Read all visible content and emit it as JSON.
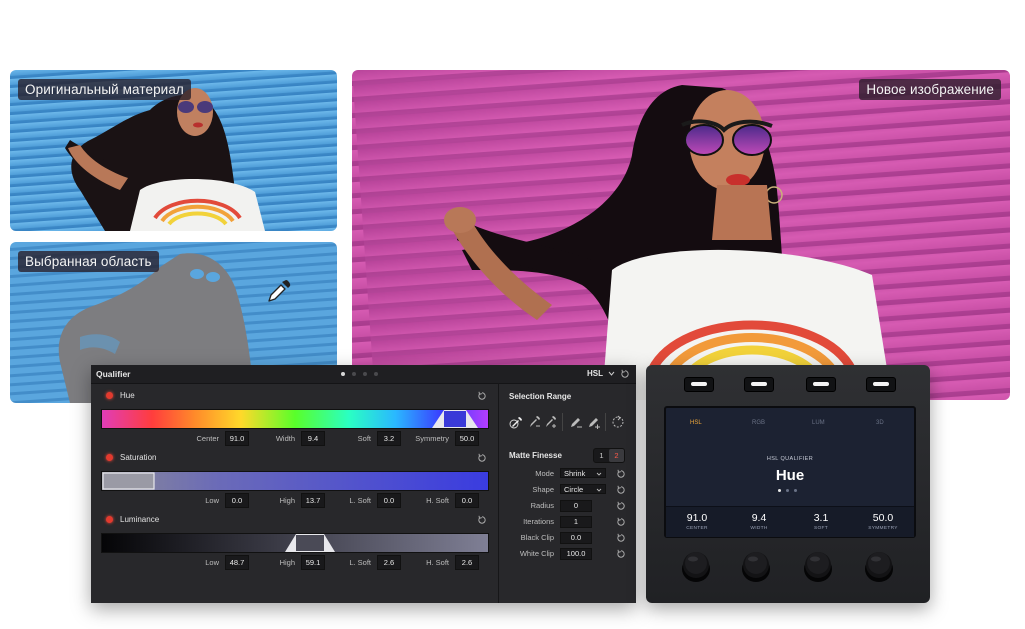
{
  "captions": {
    "original": "Оригинальный материал",
    "selected": "Выбранная область",
    "new_image": "Новое изображение"
  },
  "colors": {
    "original_wall": "#58a8e0",
    "new_wall": "#c94fa6",
    "panel_bg": "#28282b",
    "led_red": "#e23a2e",
    "screen_active_tab": "#f0a83a"
  },
  "qualifier": {
    "title": "Qualifier",
    "mode": "HSL",
    "mode_icon": "chevron-down-icon",
    "page_dots": 4,
    "active_page": 1,
    "hue": {
      "label": "Hue",
      "fields": [
        {
          "label": "Center",
          "value": "91.0"
        },
        {
          "label": "Width",
          "value": "9.4"
        },
        {
          "label": "Soft",
          "value": "3.2"
        },
        {
          "label": "Symmetry",
          "value": "50.0"
        }
      ]
    },
    "saturation": {
      "label": "Saturation",
      "fields": [
        {
          "label": "Low",
          "value": "0.0"
        },
        {
          "label": "High",
          "value": "13.7"
        },
        {
          "label": "L. Soft",
          "value": "0.0"
        },
        {
          "label": "H. Soft",
          "value": "0.0"
        }
      ]
    },
    "luminance": {
      "label": "Luminance",
      "fields": [
        {
          "label": "Low",
          "value": "48.7"
        },
        {
          "label": "High",
          "value": "59.1"
        },
        {
          "label": "L. Soft",
          "value": "2.6"
        },
        {
          "label": "H. Soft",
          "value": "2.6"
        }
      ]
    },
    "selection_range": {
      "title": "Selection Range",
      "tools": [
        "eyedropper-icon",
        "eyedropper-minus-icon",
        "eyedropper-plus-icon",
        "pen-minus-icon",
        "pen-plus-icon",
        "invert-icon"
      ]
    },
    "matte_finesse": {
      "title": "Matte Finesse",
      "tab1": "1",
      "tab2": "2",
      "rows": [
        {
          "label": "Mode",
          "value": "Shrink",
          "kind": "dropdown"
        },
        {
          "label": "Shape",
          "value": "Circle",
          "kind": "dropdown"
        },
        {
          "label": "Radius",
          "value": "0",
          "kind": "field"
        },
        {
          "label": "Iterations",
          "value": "1",
          "kind": "field"
        },
        {
          "label": "Black Clip",
          "value": "0.0",
          "kind": "field"
        },
        {
          "label": "White Clip",
          "value": "100.0",
          "kind": "field"
        }
      ]
    }
  },
  "hardware": {
    "tabs": [
      "HSL",
      "RGB",
      "LUM",
      "3D"
    ],
    "active_tab": "HSL",
    "subtitle": "HSL QUALIFIER",
    "main": "Hue",
    "values": [
      {
        "value": "91.0",
        "label": "CENTER"
      },
      {
        "value": "9.4",
        "label": "WIDTH"
      },
      {
        "value": "3.1",
        "label": "SOFT"
      },
      {
        "value": "50.0",
        "label": "SYMMETRY"
      }
    ]
  }
}
